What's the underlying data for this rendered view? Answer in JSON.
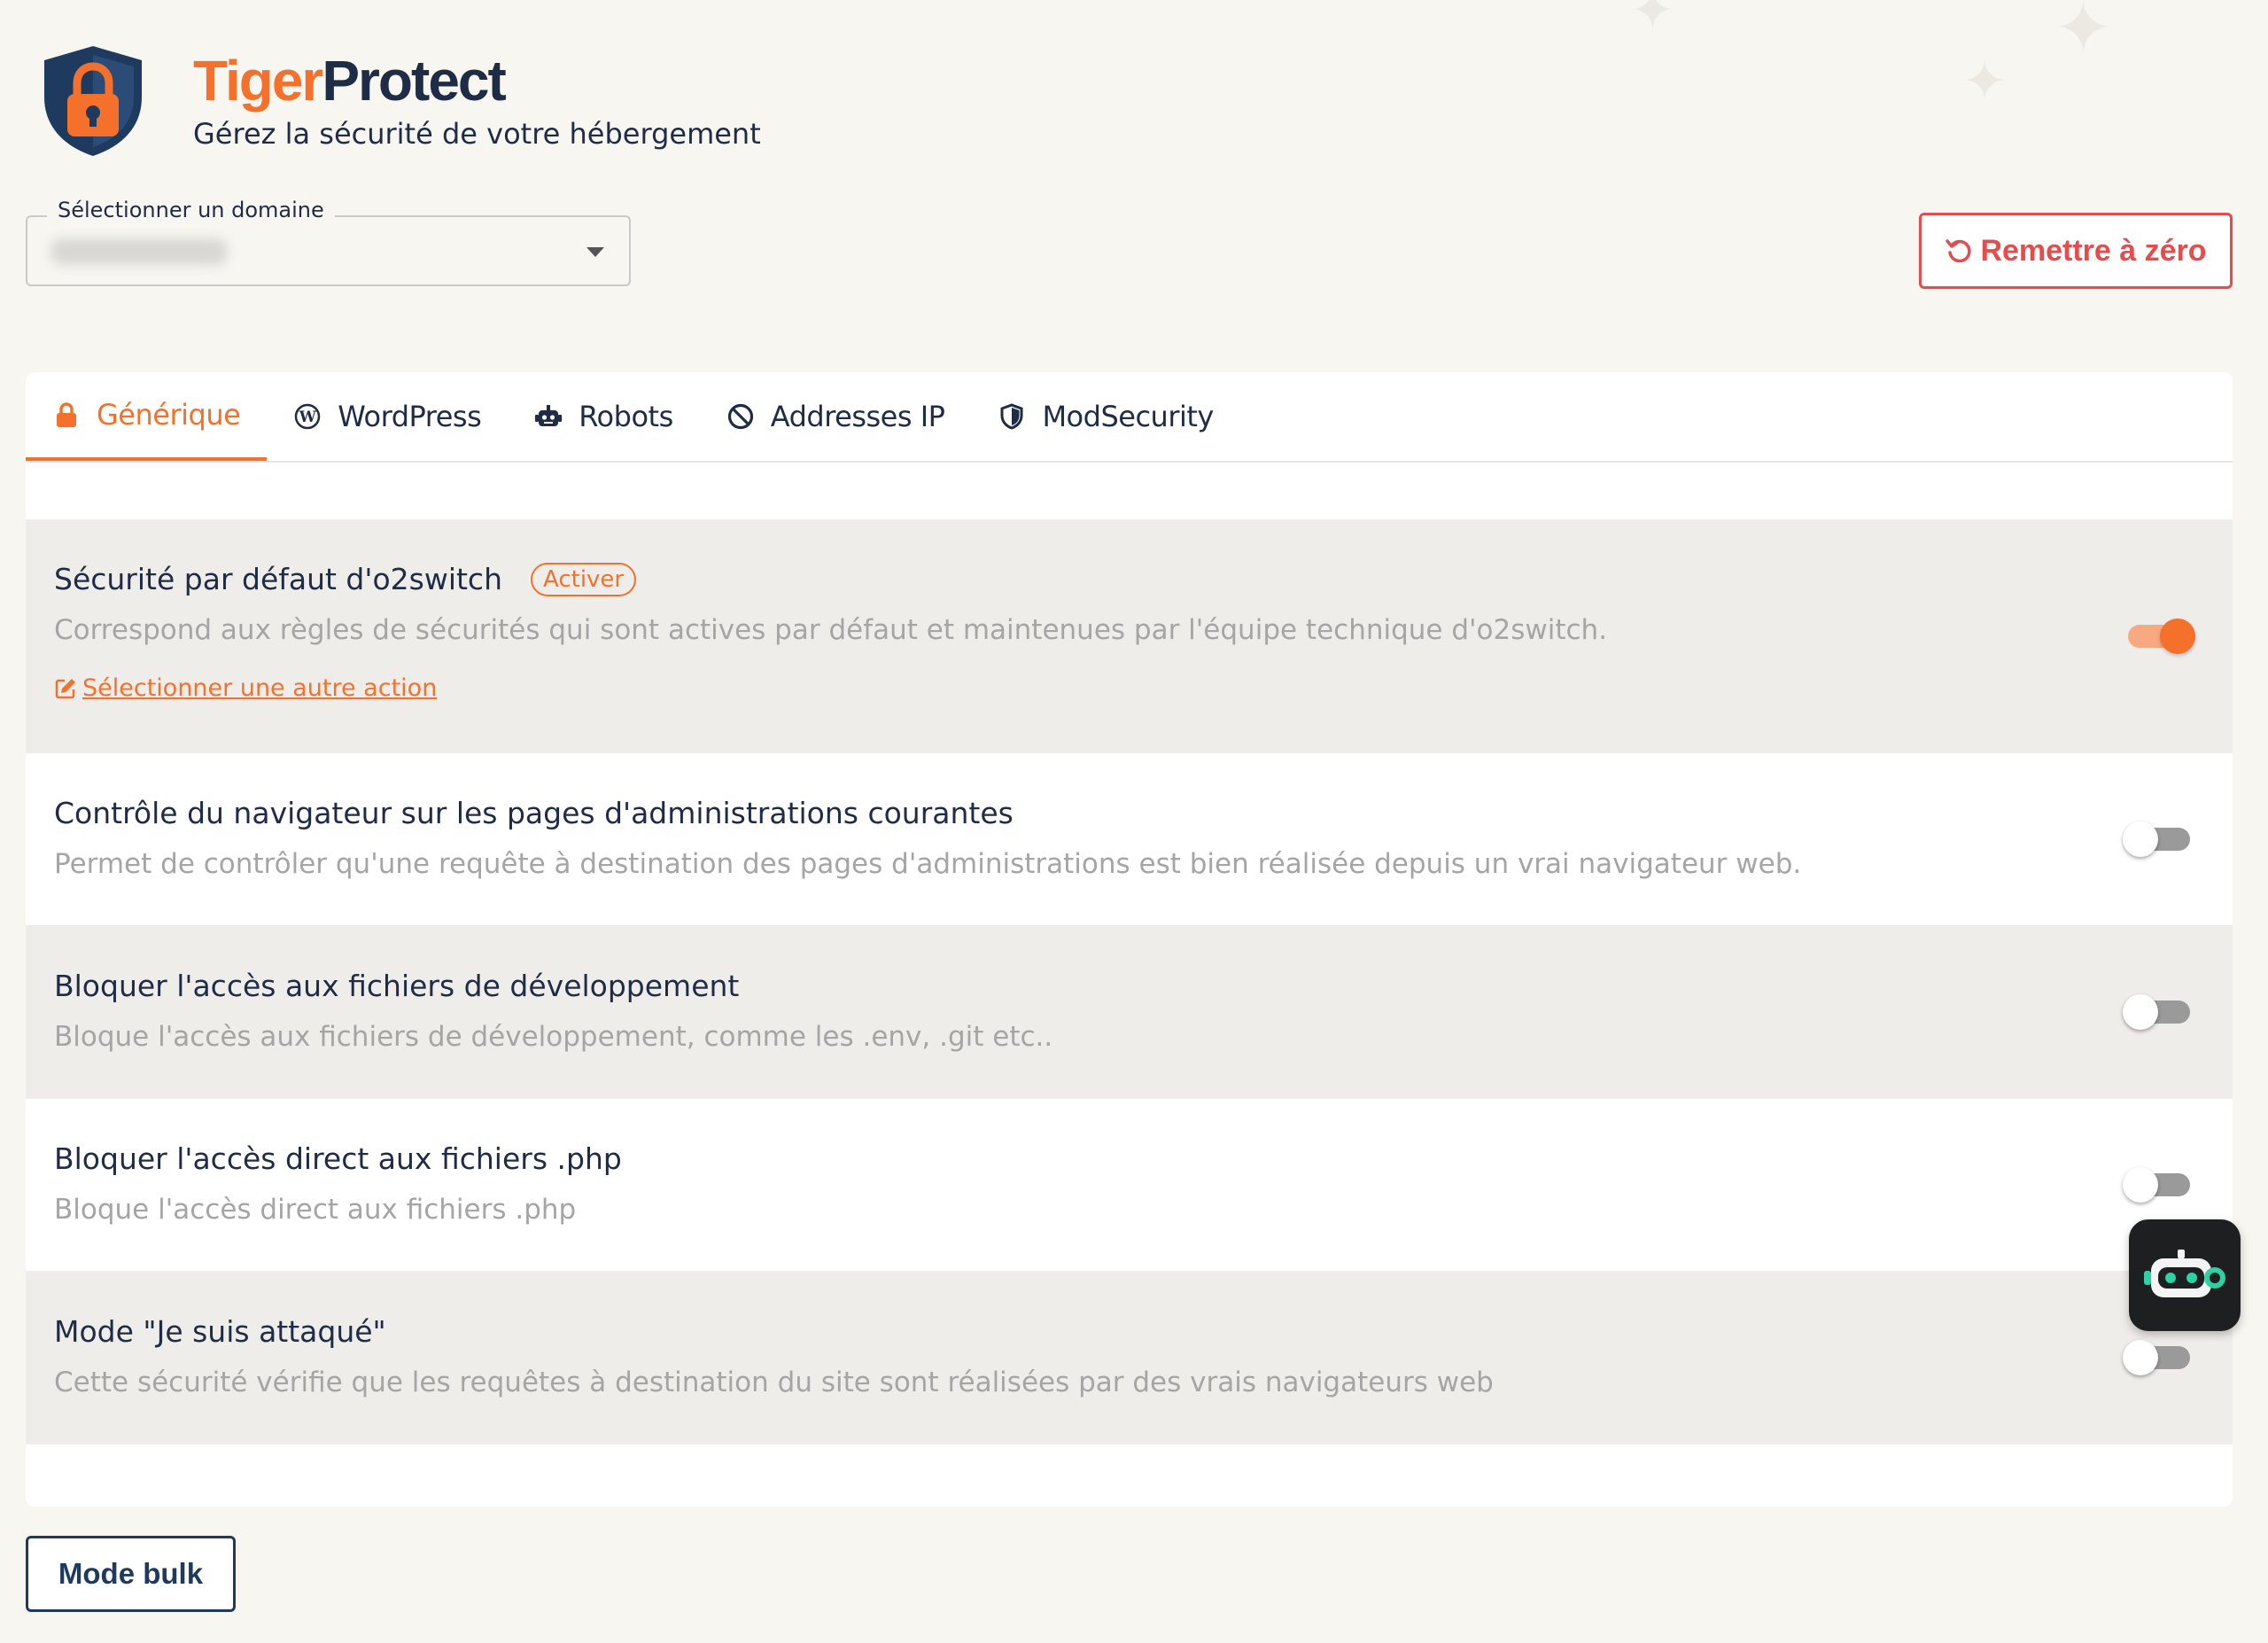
{
  "app": {
    "brand_part1": "Tiger",
    "brand_part2": "Protect",
    "subtitle": "Gérez la sécurité de votre hébergement"
  },
  "domain_select": {
    "label": "Sélectionner un domaine"
  },
  "reset_button": {
    "label": "Remettre à zéro",
    "icon": "undo-icon"
  },
  "tabs": [
    {
      "label": "Générique",
      "icon": "lock-icon",
      "active": true
    },
    {
      "label": "WordPress",
      "icon": "wordpress-icon",
      "active": false
    },
    {
      "label": "Robots",
      "icon": "robot-icon",
      "active": false
    },
    {
      "label": "Addresses IP",
      "icon": "ban-icon",
      "active": false
    },
    {
      "label": "ModSecurity",
      "icon": "shield-icon",
      "active": false
    }
  ],
  "rules": [
    {
      "title": "Sécurité par défaut d'o2switch",
      "badge": "Activer",
      "description": "Correspond aux règles de sécurités qui sont actives par défaut et maintenues par l'équipe technique d'o2switch.",
      "link": "Sélectionner une autre action",
      "enabled": true
    },
    {
      "title": "Contrôle du navigateur sur les pages d'administrations courantes",
      "description": "Permet de contrôler qu'une requête à destination des pages d'administrations est bien réalisée depuis un vrai navigateur web.",
      "enabled": false
    },
    {
      "title": "Bloquer l'accès aux fichiers de développement",
      "description": "Bloque l'accès aux fichiers de développement, comme les .env, .git etc..",
      "enabled": false
    },
    {
      "title": "Bloquer l'accès direct aux fichiers .php",
      "description": "Bloque l'accès direct aux fichiers .php",
      "enabled": false
    },
    {
      "title": "Mode \"Je suis attaqué\"",
      "description": "Cette sécurité vérifie que les requêtes à destination du site sont réalisées par des vrais navigateurs web",
      "enabled": false
    }
  ],
  "bulk_button": {
    "label": "Mode bulk"
  },
  "colors": {
    "accent": "#f5712b",
    "danger": "#e84b4b",
    "navy": "#1f2c46",
    "background": "#f8f6f1"
  }
}
